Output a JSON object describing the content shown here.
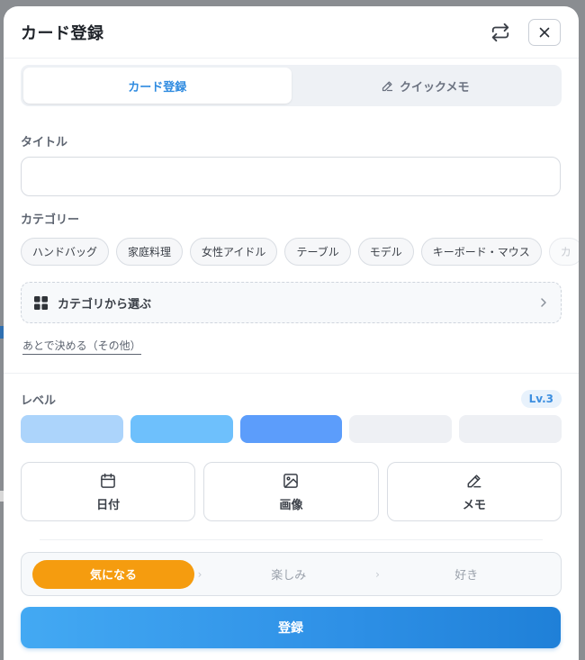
{
  "header": {
    "title": "カード登録",
    "swap_icon": "swap-icon",
    "close_icon": "close-icon"
  },
  "tabs": [
    {
      "label": "カード登録",
      "active": true
    },
    {
      "label": "クイックメモ",
      "active": false,
      "icon": "pencil-icon"
    }
  ],
  "form": {
    "title_label": "タイトル",
    "title_value": "",
    "title_placeholder": "",
    "category_label": "カテゴリー",
    "categories": [
      "ハンドバッグ",
      "家庭料理",
      "女性アイドル",
      "テーブル",
      "モデル",
      "キーボード・マウス",
      "カ"
    ],
    "pick_category_label": "カテゴリから選ぶ",
    "decide_later_label": "あとで決める（その他）"
  },
  "level": {
    "label": "レベル",
    "badge": "Lv.3",
    "current": 3,
    "max": 5,
    "colors": [
      "#acd4fb",
      "#6ec0fc",
      "#5c9dfb",
      "#eef0f4",
      "#eef0f4"
    ]
  },
  "actions": [
    {
      "label": "日付",
      "icon": "calendar-icon"
    },
    {
      "label": "画像",
      "icon": "image-icon"
    },
    {
      "label": "メモ",
      "icon": "pencil-icon"
    }
  ],
  "feelings": {
    "steps": [
      "気になる",
      "楽しみ",
      "好き"
    ],
    "active_index": 0,
    "active_color": "#f59c0f"
  },
  "submit_label": "登録",
  "colors": {
    "accent": "#2f8be0",
    "submit_start": "#43a9f3",
    "submit_end": "#1f80d8"
  }
}
